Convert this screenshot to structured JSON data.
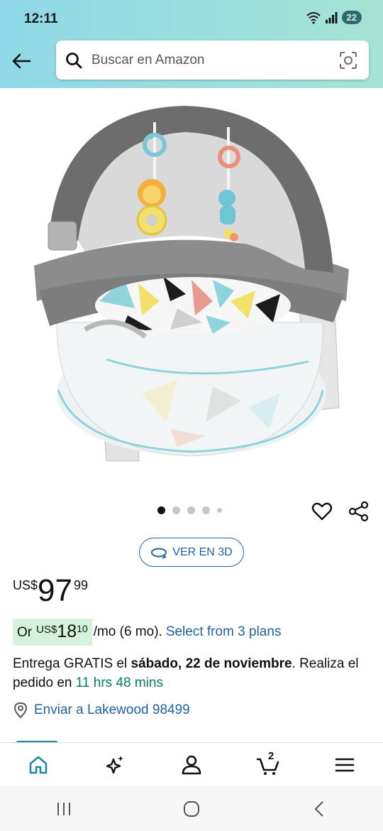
{
  "status_bar": {
    "time": "12:11",
    "battery": "22"
  },
  "search": {
    "placeholder": "Buscar en Amazon"
  },
  "carousel": {
    "dot_count": 5,
    "active_index": 0
  },
  "view3d_label": "VER EN 3D",
  "price": {
    "currency": "US$",
    "whole": "97",
    "fraction": "99"
  },
  "monthly": {
    "or": "Or",
    "currency": "US$",
    "whole": "18",
    "fraction": "10",
    "suffix": "/mo (6 mo).",
    "plans_link": "Select from 3 plans"
  },
  "delivery": {
    "prefix": "Entrega GRATIS el ",
    "date": "sábado, 22 de noviembre",
    "middle": ". Realiza el pedido en ",
    "countdown": "11 hrs 48 mins"
  },
  "ship_to": "Enviar a Lakewood 98499",
  "bottom_nav": {
    "items": [
      "home",
      "rufus",
      "account",
      "cart",
      "menu"
    ],
    "cart_count": "2"
  },
  "colors": {
    "header_start": "#8fd9e8",
    "header_end": "#a6e3d4",
    "link": "#2162a1",
    "countdown": "#067d62",
    "home_active": "#1f8aa6"
  }
}
